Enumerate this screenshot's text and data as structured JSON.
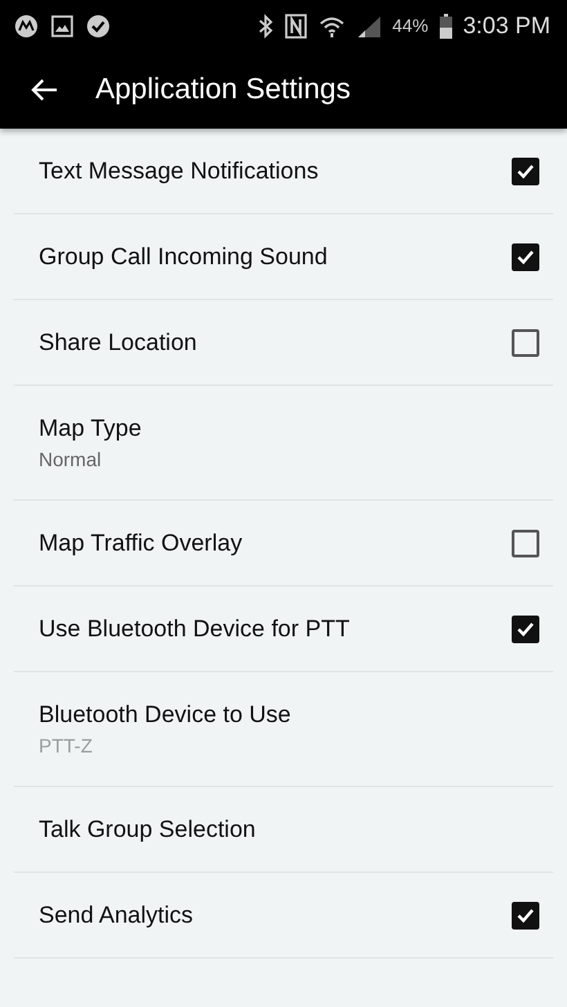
{
  "status_bar": {
    "battery": "44%",
    "time": "3:03 PM"
  },
  "toolbar": {
    "title": "Application Settings"
  },
  "settings": [
    {
      "kind": "checkbox",
      "title": "Text Message Notifications",
      "checked": true
    },
    {
      "kind": "checkbox",
      "title": "Group Call Incoming Sound",
      "checked": true
    },
    {
      "kind": "checkbox",
      "title": "Share Location",
      "checked": false
    },
    {
      "kind": "summary",
      "title": "Map Type",
      "summary": "Normal",
      "summary_dimmed": false
    },
    {
      "kind": "checkbox",
      "title": "Map Traffic Overlay",
      "checked": false
    },
    {
      "kind": "checkbox",
      "title": "Use Bluetooth Device for PTT",
      "checked": true
    },
    {
      "kind": "summary",
      "title": "Bluetooth Device to Use",
      "summary": "PTT-Z",
      "summary_dimmed": true
    },
    {
      "kind": "plain",
      "title": "Talk Group Selection"
    },
    {
      "kind": "checkbox",
      "title": "Send Analytics",
      "checked": true
    }
  ]
}
